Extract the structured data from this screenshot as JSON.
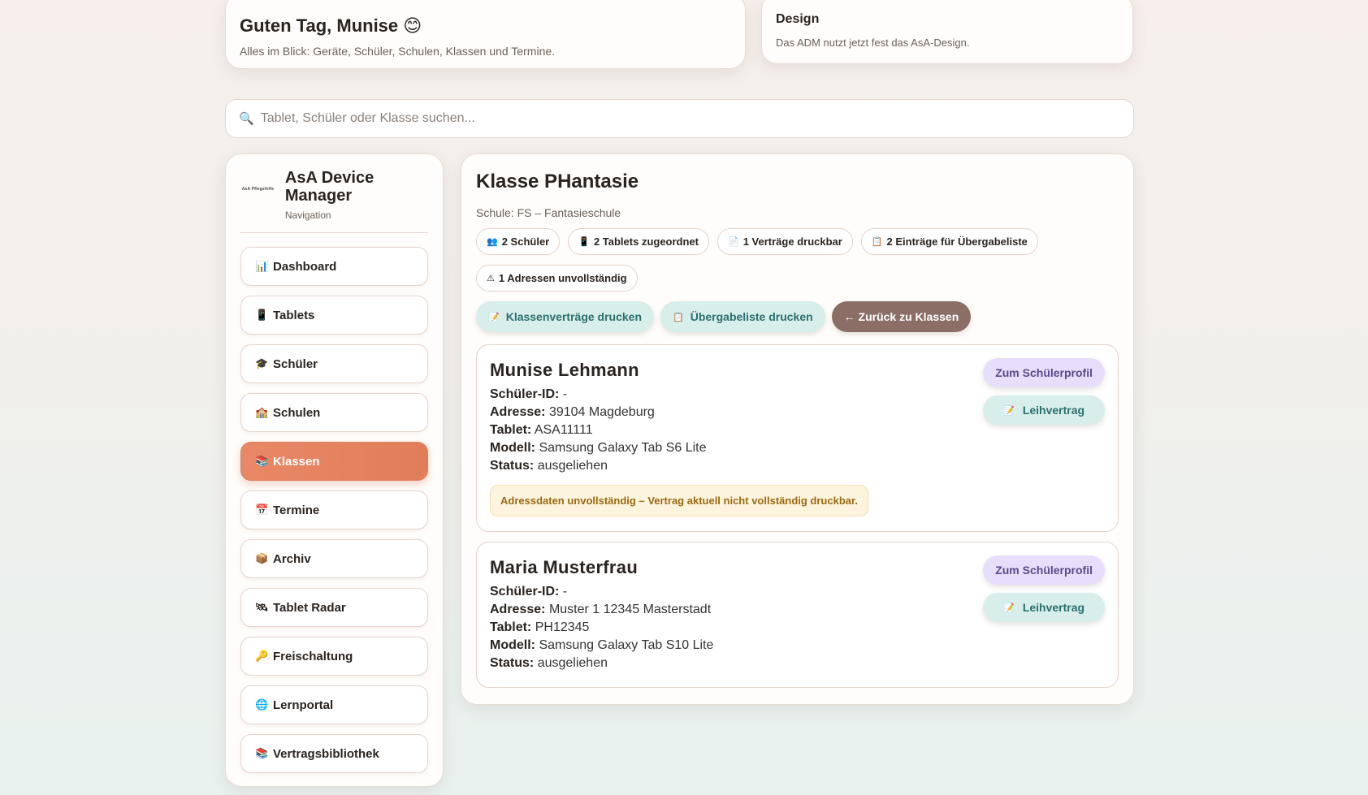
{
  "greeting": {
    "title": "Guten Tag, Munise 😊",
    "subtitle": "Alles im Blick: Geräte, Schüler, Schulen, Klassen und Termine."
  },
  "design": {
    "title": "Design",
    "text": "Das ADM nutzt jetzt fest das AsA-Design."
  },
  "search": {
    "placeholder": "Tablet, Schüler oder Klasse suchen..."
  },
  "sidebar": {
    "logo_text": "AsA Pflegehilfe",
    "title": "AsA Device Manager",
    "subtitle": "Navigation",
    "items": [
      {
        "label": "Dashboard",
        "icon": "📊"
      },
      {
        "label": "Tablets",
        "icon": "📱"
      },
      {
        "label": "Schüler",
        "icon": "🎓"
      },
      {
        "label": "Schulen",
        "icon": "🏫"
      },
      {
        "label": "Klassen",
        "icon": "📚"
      },
      {
        "label": "Termine",
        "icon": "📅"
      },
      {
        "label": "Archiv",
        "icon": "📦"
      },
      {
        "label": "Tablet Radar",
        "icon": "🛰"
      },
      {
        "label": "Freischaltung",
        "icon": "🔑"
      },
      {
        "label": "Lernportal",
        "icon": "🌐"
      },
      {
        "label": "Vertragsbibliothek",
        "icon": "📚"
      }
    ],
    "active_index": 4
  },
  "main": {
    "title": "Klasse PHantasie",
    "school": "Schule: FS – Fantasieschule",
    "pills": [
      {
        "icon": "👥",
        "label": "2 Schüler"
      },
      {
        "icon": "📱",
        "label": "2 Tablets zugeordnet"
      },
      {
        "icon": "📄",
        "label": "1 Verträge druckbar"
      },
      {
        "icon": "📋",
        "label": "2 Einträge für Übergabeliste"
      },
      {
        "icon": "⚠",
        "label": "1 Adressen unvollständig"
      }
    ],
    "actions": {
      "print_contracts": {
        "icon": "📝",
        "label": "Klassenverträge drucken"
      },
      "print_list": {
        "icon": "📋",
        "label": "Übergabeliste drucken"
      },
      "back": {
        "label": "← Zurück zu Klassen"
      }
    },
    "students": [
      {
        "name": "Munise Lehmann",
        "id_label": "Schüler-ID:",
        "id": "-",
        "address_label": "Adresse:",
        "address": "39104 Magdeburg",
        "tablet_label": "Tablet:",
        "tablet": "ASA11111",
        "model_label": "Modell:",
        "model": "Samsung Galaxy Tab S6 Lite",
        "status_label": "Status:",
        "status": "ausgeliehen",
        "warning": "Adressdaten unvollständig – Vertrag aktuell nicht vollständig druckbar.",
        "profile_btn": "Zum Schülerprofil",
        "contract_btn": "Leihvertrag"
      },
      {
        "name": "Maria Musterfrau",
        "id_label": "Schüler-ID:",
        "id": "-",
        "address_label": "Adresse:",
        "address": "Muster 1 12345 Masterstadt",
        "tablet_label": "Tablet:",
        "tablet": "PH12345",
        "model_label": "Modell:",
        "model": "Samsung Galaxy Tab S10 Lite",
        "status_label": "Status:",
        "status": "ausgeliehen",
        "profile_btn": "Zum Schülerprofil",
        "contract_btn": "Leihvertrag"
      }
    ]
  },
  "colors": {
    "accent": "#e07e5c",
    "teal_button": "#d7eeeb",
    "purple_button": "#e6defa",
    "back_button": "#8b6e66",
    "warning_bg": "#fdf4de"
  }
}
